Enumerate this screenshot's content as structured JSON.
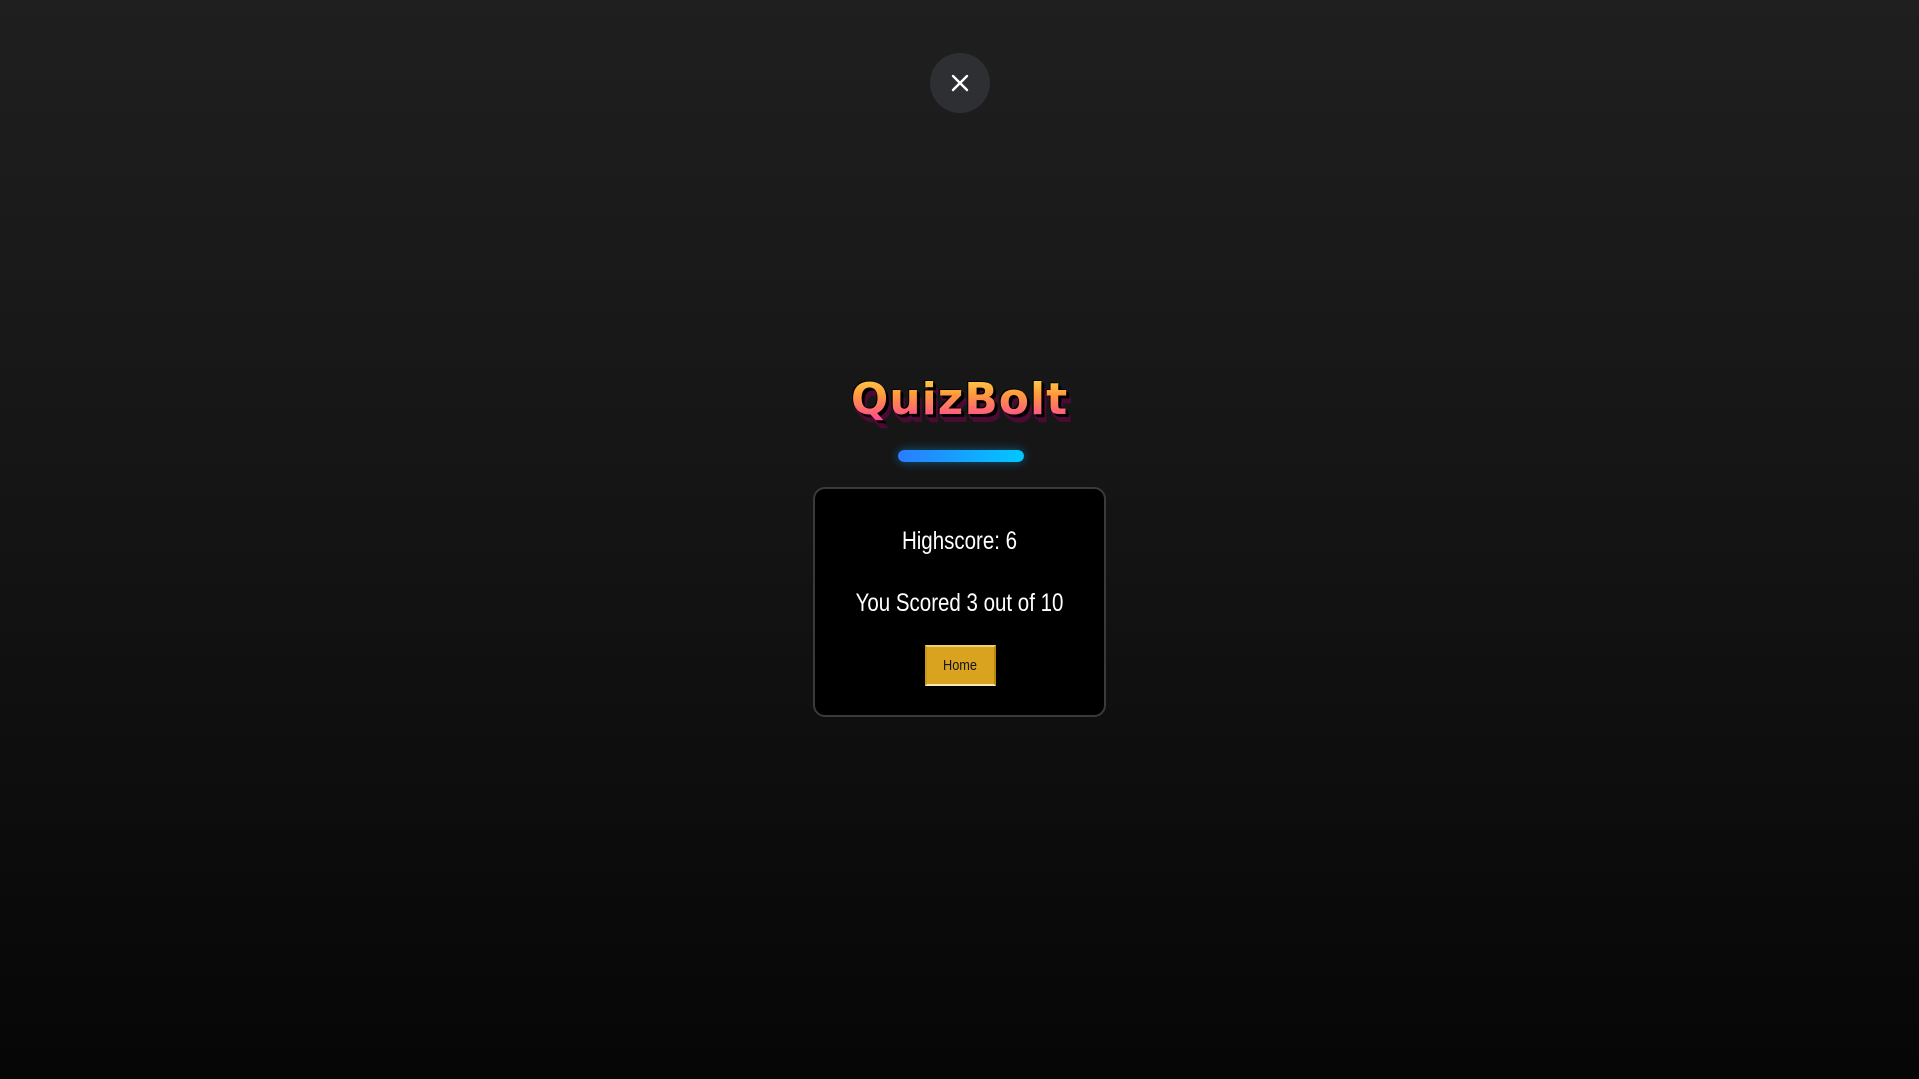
{
  "app": {
    "logo_text": "QuizBolt"
  },
  "controls": {
    "close_icon": "close-icon"
  },
  "progress": {
    "value_fraction": 1.0,
    "color_start": "#2b7cff",
    "color_end": "#00c8ff"
  },
  "result": {
    "highscore_text": "Highscore: 6",
    "score_text": "You Scored 3 out of 10",
    "home_label": "Home"
  },
  "colors": {
    "accent_button": "#d9a21f",
    "card_background": "#000000"
  }
}
